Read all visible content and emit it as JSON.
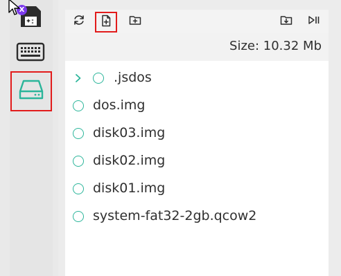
{
  "sidebar": {
    "floppy_badge": "X",
    "items": [
      {
        "name": "floppy-disk",
        "icon": "floppy-icon"
      },
      {
        "name": "keyboard",
        "icon": "keyboard-icon"
      },
      {
        "name": "drive",
        "icon": "hard-drive-icon",
        "active": true
      }
    ]
  },
  "toolbar": {
    "buttons": [
      {
        "name": "refresh",
        "icon": "refresh-icon"
      },
      {
        "name": "new-file",
        "icon": "new-file-icon",
        "highlighted": true
      },
      {
        "name": "new-folder",
        "icon": "new-folder-icon"
      },
      {
        "name": "download",
        "icon": "download-icon"
      },
      {
        "name": "run",
        "icon": "play-pause-icon"
      }
    ]
  },
  "size": {
    "label": "Size: 10.32 Mb"
  },
  "files": [
    {
      "name": ".jsdos",
      "type": "folder"
    },
    {
      "name": "dos.img",
      "type": "file"
    },
    {
      "name": "disk03.img",
      "type": "file"
    },
    {
      "name": "disk02.img",
      "type": "file"
    },
    {
      "name": "disk01.img",
      "type": "file"
    },
    {
      "name": "system-fat32-2gb.qcow2",
      "type": "file"
    }
  ],
  "colors": {
    "accent": "#2bb59a",
    "highlight": "#e21b1b",
    "badge": "#7c3aed"
  }
}
